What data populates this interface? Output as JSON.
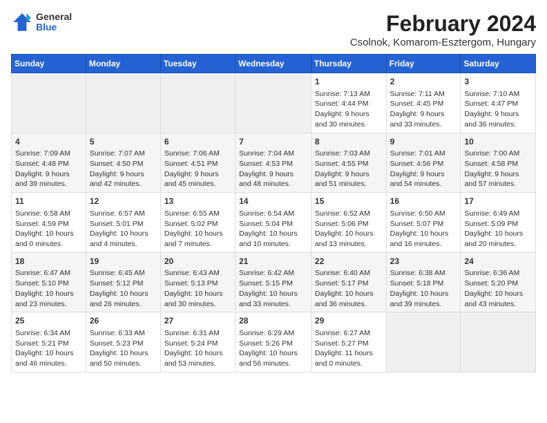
{
  "header": {
    "logo": {
      "general": "General",
      "blue": "Blue"
    },
    "title": "February 2024",
    "subtitle": "Csolnok, Komarom-Esztergom, Hungary"
  },
  "weekdays": [
    "Sunday",
    "Monday",
    "Tuesday",
    "Wednesday",
    "Thursday",
    "Friday",
    "Saturday"
  ],
  "weeks": [
    [
      {
        "day": "",
        "empty": true
      },
      {
        "day": "",
        "empty": true
      },
      {
        "day": "",
        "empty": true
      },
      {
        "day": "",
        "empty": true
      },
      {
        "day": "1",
        "sunrise": "Sunrise: 7:13 AM",
        "sunset": "Sunset: 4:44 PM",
        "daylight": "Daylight: 9 hours and 30 minutes."
      },
      {
        "day": "2",
        "sunrise": "Sunrise: 7:11 AM",
        "sunset": "Sunset: 4:45 PM",
        "daylight": "Daylight: 9 hours and 33 minutes."
      },
      {
        "day": "3",
        "sunrise": "Sunrise: 7:10 AM",
        "sunset": "Sunset: 4:47 PM",
        "daylight": "Daylight: 9 hours and 36 minutes."
      }
    ],
    [
      {
        "day": "4",
        "sunrise": "Sunrise: 7:09 AM",
        "sunset": "Sunset: 4:48 PM",
        "daylight": "Daylight: 9 hours and 39 minutes."
      },
      {
        "day": "5",
        "sunrise": "Sunrise: 7:07 AM",
        "sunset": "Sunset: 4:50 PM",
        "daylight": "Daylight: 9 hours and 42 minutes."
      },
      {
        "day": "6",
        "sunrise": "Sunrise: 7:06 AM",
        "sunset": "Sunset: 4:51 PM",
        "daylight": "Daylight: 9 hours and 45 minutes."
      },
      {
        "day": "7",
        "sunrise": "Sunrise: 7:04 AM",
        "sunset": "Sunset: 4:53 PM",
        "daylight": "Daylight: 9 hours and 48 minutes."
      },
      {
        "day": "8",
        "sunrise": "Sunrise: 7:03 AM",
        "sunset": "Sunset: 4:55 PM",
        "daylight": "Daylight: 9 hours and 51 minutes."
      },
      {
        "day": "9",
        "sunrise": "Sunrise: 7:01 AM",
        "sunset": "Sunset: 4:56 PM",
        "daylight": "Daylight: 9 hours and 54 minutes."
      },
      {
        "day": "10",
        "sunrise": "Sunrise: 7:00 AM",
        "sunset": "Sunset: 4:58 PM",
        "daylight": "Daylight: 9 hours and 57 minutes."
      }
    ],
    [
      {
        "day": "11",
        "sunrise": "Sunrise: 6:58 AM",
        "sunset": "Sunset: 4:59 PM",
        "daylight": "Daylight: 10 hours and 0 minutes."
      },
      {
        "day": "12",
        "sunrise": "Sunrise: 6:57 AM",
        "sunset": "Sunset: 5:01 PM",
        "daylight": "Daylight: 10 hours and 4 minutes."
      },
      {
        "day": "13",
        "sunrise": "Sunrise: 6:55 AM",
        "sunset": "Sunset: 5:02 PM",
        "daylight": "Daylight: 10 hours and 7 minutes."
      },
      {
        "day": "14",
        "sunrise": "Sunrise: 6:54 AM",
        "sunset": "Sunset: 5:04 PM",
        "daylight": "Daylight: 10 hours and 10 minutes."
      },
      {
        "day": "15",
        "sunrise": "Sunrise: 6:52 AM",
        "sunset": "Sunset: 5:06 PM",
        "daylight": "Daylight: 10 hours and 13 minutes."
      },
      {
        "day": "16",
        "sunrise": "Sunrise: 6:50 AM",
        "sunset": "Sunset: 5:07 PM",
        "daylight": "Daylight: 10 hours and 16 minutes."
      },
      {
        "day": "17",
        "sunrise": "Sunrise: 6:49 AM",
        "sunset": "Sunset: 5:09 PM",
        "daylight": "Daylight: 10 hours and 20 minutes."
      }
    ],
    [
      {
        "day": "18",
        "sunrise": "Sunrise: 6:47 AM",
        "sunset": "Sunset: 5:10 PM",
        "daylight": "Daylight: 10 hours and 23 minutes."
      },
      {
        "day": "19",
        "sunrise": "Sunrise: 6:45 AM",
        "sunset": "Sunset: 5:12 PM",
        "daylight": "Daylight: 10 hours and 26 minutes."
      },
      {
        "day": "20",
        "sunrise": "Sunrise: 6:43 AM",
        "sunset": "Sunset: 5:13 PM",
        "daylight": "Daylight: 10 hours and 30 minutes."
      },
      {
        "day": "21",
        "sunrise": "Sunrise: 6:42 AM",
        "sunset": "Sunset: 5:15 PM",
        "daylight": "Daylight: 10 hours and 33 minutes."
      },
      {
        "day": "22",
        "sunrise": "Sunrise: 6:40 AM",
        "sunset": "Sunset: 5:17 PM",
        "daylight": "Daylight: 10 hours and 36 minutes."
      },
      {
        "day": "23",
        "sunrise": "Sunrise: 6:38 AM",
        "sunset": "Sunset: 5:18 PM",
        "daylight": "Daylight: 10 hours and 39 minutes."
      },
      {
        "day": "24",
        "sunrise": "Sunrise: 6:36 AM",
        "sunset": "Sunset: 5:20 PM",
        "daylight": "Daylight: 10 hours and 43 minutes."
      }
    ],
    [
      {
        "day": "25",
        "sunrise": "Sunrise: 6:34 AM",
        "sunset": "Sunset: 5:21 PM",
        "daylight": "Daylight: 10 hours and 46 minutes."
      },
      {
        "day": "26",
        "sunrise": "Sunrise: 6:33 AM",
        "sunset": "Sunset: 5:23 PM",
        "daylight": "Daylight: 10 hours and 50 minutes."
      },
      {
        "day": "27",
        "sunrise": "Sunrise: 6:31 AM",
        "sunset": "Sunset: 5:24 PM",
        "daylight": "Daylight: 10 hours and 53 minutes."
      },
      {
        "day": "28",
        "sunrise": "Sunrise: 6:29 AM",
        "sunset": "Sunset: 5:26 PM",
        "daylight": "Daylight: 10 hours and 56 minutes."
      },
      {
        "day": "29",
        "sunrise": "Sunrise: 6:27 AM",
        "sunset": "Sunset: 5:27 PM",
        "daylight": "Daylight: 11 hours and 0 minutes."
      },
      {
        "day": "",
        "empty": true
      },
      {
        "day": "",
        "empty": true
      }
    ]
  ]
}
